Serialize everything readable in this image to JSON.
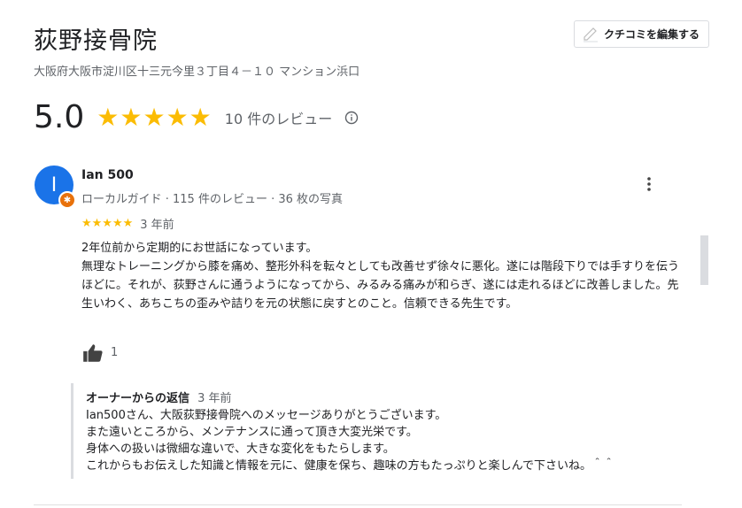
{
  "place": {
    "title": "荻野接骨院",
    "address": "大阪府大阪市淀川区十三元今里３丁目４－１０ マンション浜口",
    "rating": "5.0",
    "stars": "★★★★★",
    "review_count": "10 件のレビュー"
  },
  "edit_button": {
    "label": "クチコミを編集する"
  },
  "review": {
    "avatar_letter": "I",
    "name": "Ian 500",
    "meta": "ローカルガイド · 115 件のレビュー · 36 枚の写真",
    "stars": "★★★★★",
    "time": "3 年前",
    "text": "2年位前から定期的にお世話になっています。\n無理なトレーニングから膝を痛め、整形外科を転々としても改善せず徐々に悪化。遂には階段下りでは手すりを伝うほどに。それが、荻野さんに通うようになってから、みるみる痛みが和らぎ、遂には走れるほどに改善しました。先生いわく、あちこちの歪みや詰りを元の状態に戻すとのこと。信頼できる先生です。",
    "likes": "1"
  },
  "owner_reply": {
    "label": "オーナーからの返信",
    "time": "3 年前",
    "text": "Ian500さん、大阪荻野接骨院へのメッセージありがとうございます。\nまた遠いところから、メンテナンスに通って頂き大変光栄です。\n身体への扱いは微細な違いで、大きな変化をもたらします。\nこれからもお伝えした知識と情報を元に、健康を保ち、趣味の方もたっぷりと楽しんで下さいね。＾＾"
  },
  "colors": {
    "star": "#fbbc04",
    "avatar": "#1a73e8",
    "guide_badge": "#e8710a",
    "text": "#202124",
    "secondary_text": "#5f6368"
  }
}
